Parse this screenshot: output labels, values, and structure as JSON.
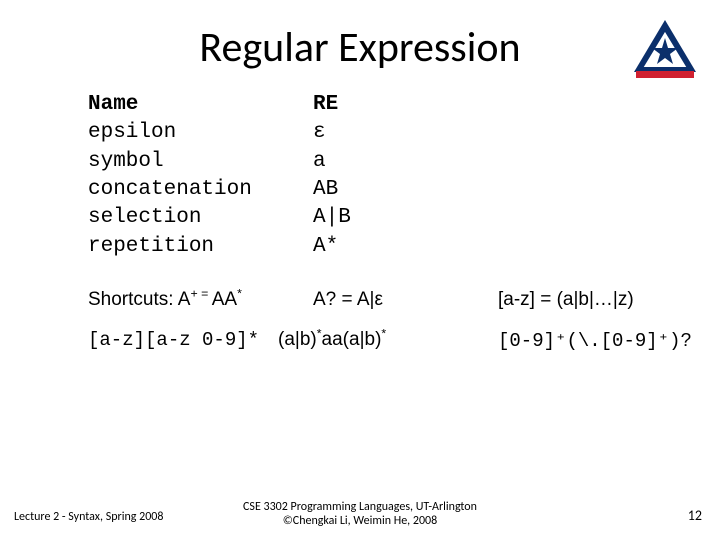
{
  "title": "Regular Expression",
  "table": {
    "header": {
      "name": "Name",
      "re": "RE"
    },
    "rows": [
      {
        "name": "epsilon",
        "re": "ε"
      },
      {
        "name": "symbol",
        "re": "a"
      },
      {
        "name": "concatenation",
        "re": "AB"
      },
      {
        "name": "selection",
        "re": "A|B"
      },
      {
        "name": "repetition",
        "re": "A*"
      }
    ]
  },
  "shortcuts_label": "Shortcuts: ",
  "shortcut_aplus_lhs": "A",
  "shortcut_aplus_sup": "+ = ",
  "shortcut_aplus_rhs": "AA",
  "shortcut_aplus_rhs_sup": "*",
  "shortcut_aq": "A? = A|ε",
  "shortcut_range": "[a-z] = (a|b|…|z)",
  "examples": [
    {
      "c1": "[a-z][a-z 0-9]*",
      "c2_pre": "(a|b)",
      "c2_sup1": "*",
      "c2_mid": "aa(a|b)",
      "c2_sup2": "*",
      "c3": "[0-9]⁺(\\.[0-9]⁺)?"
    }
  ],
  "footer_left": "Lecture 2 - Syntax, Spring 2008",
  "footer_center_l1": "CSE 3302 Programming Languages, UT-Arlington",
  "footer_center_l2": "©Chengkai Li, Weimin He, 2008",
  "footer_right": "12"
}
